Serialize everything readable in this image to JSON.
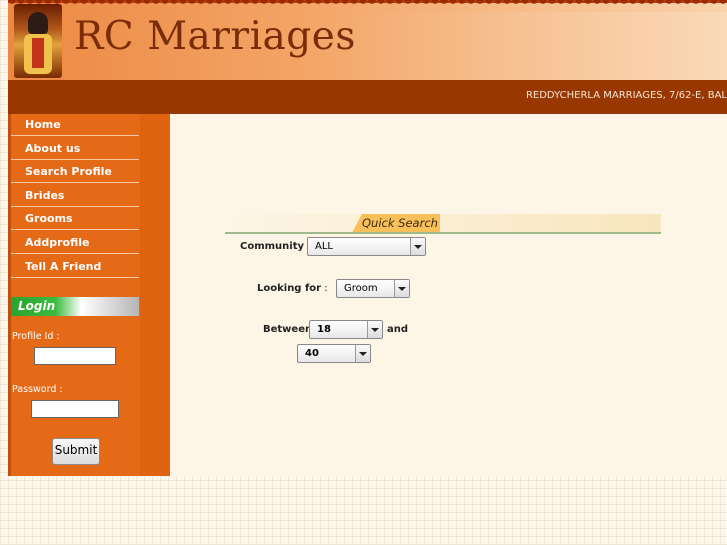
{
  "header": {
    "site_title": "RC Marriages",
    "address": "REDDYCHERLA MARRIAGES, 7/62-E, BAL"
  },
  "nav": {
    "items": [
      {
        "label": "Home"
      },
      {
        "label": "About us"
      },
      {
        "label": "Search Profile"
      },
      {
        "label": "Brides"
      },
      {
        "label": "Grooms"
      },
      {
        "label": "Addprofile"
      },
      {
        "label": "Tell A Friend"
      }
    ]
  },
  "login": {
    "heading": "Login",
    "profile_id_label": "Profile Id :",
    "profile_id_value": "",
    "password_label": "Password :",
    "password_value": "",
    "submit_label": "Submit"
  },
  "quick_search": {
    "heading": "Quick Search",
    "community_label": "Community",
    "community_value": "ALL",
    "looking_for_label": "Looking for",
    "looking_for_value": "Groom",
    "between_label": "Between",
    "age_from_value": "18",
    "and_label": "and",
    "age_to_value": "40"
  },
  "colors": {
    "header_orange": "#f19a55",
    "address_bar": "#993700",
    "sidebar_orange": "#e56a18",
    "login_green": "#3dbb41",
    "quick_search_tab": "#f8c05a"
  }
}
